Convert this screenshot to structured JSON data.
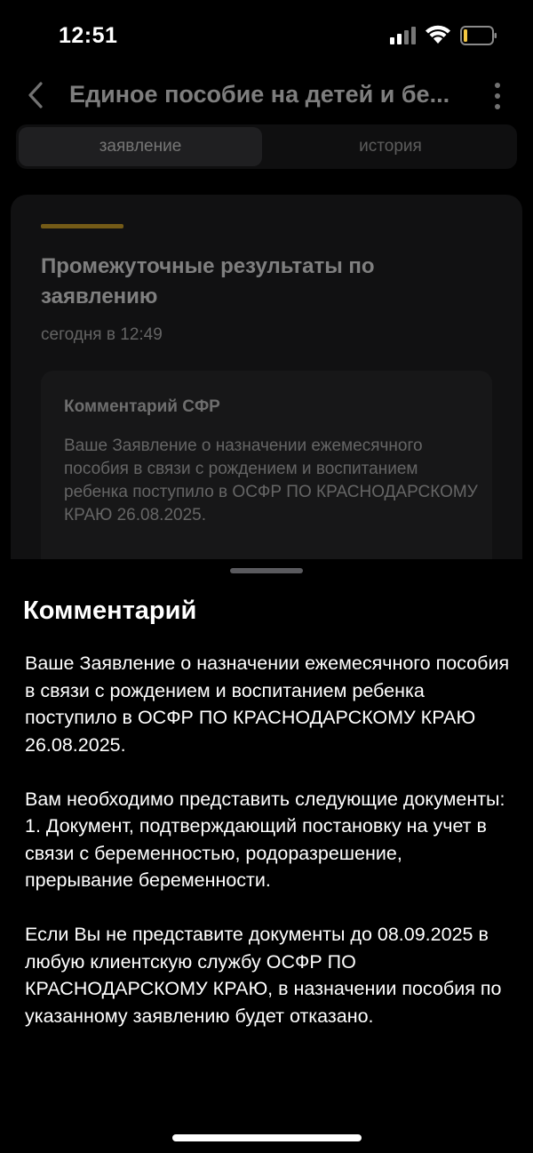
{
  "status_bar": {
    "time": "12:51"
  },
  "nav": {
    "title": "Единое пособие на детей и бе..."
  },
  "tabs": [
    {
      "label": "заявление",
      "active": true
    },
    {
      "label": "история",
      "active": false
    }
  ],
  "card": {
    "title": "Промежуточные результаты по заявлению",
    "time": "сегодня в 12:49",
    "comment_label": "Комментарий СФР",
    "comment_preview": "Ваше Заявление о назначении ежемесячного пособия в связи с рождением и воспитанием ребенка поступило в ОСФР ПО КРАСНОДАРСКОМУ КРАЮ 26.08.2025.",
    "accent_color": "#d4a62a"
  },
  "sheet": {
    "title": "Комментарий",
    "body": "Ваше Заявление о назначении ежемесячного пособия в связи с рождением и воспитанием ребенка поступило в ОСФР ПО КРАСНОДАРСКОМУ КРАЮ 26.08.2025.\n\nВам необходимо представить следующие документы:\n1. Документ, подтверждающий постановку на учет в связи с беременностью, родоразрешение, прерывание беременности.\n\nЕсли Вы не представите документы до 08.09.2025 в любую клиентскую службу ОСФР ПО КРАСНОДАРСКОМУ КРАЮ, в назначении пособия по указанному заявлению будет отказано."
  }
}
